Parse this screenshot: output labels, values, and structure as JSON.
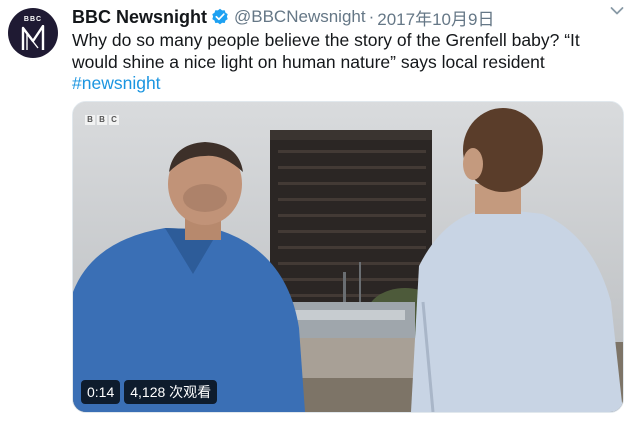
{
  "account": {
    "display_name": "BBC Newsnight",
    "handle": "@BBCNewsnight",
    "separator": "·",
    "date": "2017年10月9日",
    "avatar_text": "BBC",
    "avatar_logo": "N"
  },
  "tweet": {
    "text_line1": "Why do so many people believe the story of the Grenfell baby? “It",
    "text_line2": "would shine a nice light on human nature” says local resident",
    "hashtag": "#newsnight"
  },
  "video": {
    "watermark": [
      "B",
      "B",
      "C"
    ],
    "duration": "0:14",
    "views": "4,128 次观看"
  },
  "icons": {
    "verified": "verified-badge-icon",
    "menu": "chevron-down-icon"
  },
  "colors": {
    "link": "#1b95e0",
    "verified": "#1da1f2",
    "avatar_bg": "#1f1a33",
    "muted": "#657786"
  }
}
